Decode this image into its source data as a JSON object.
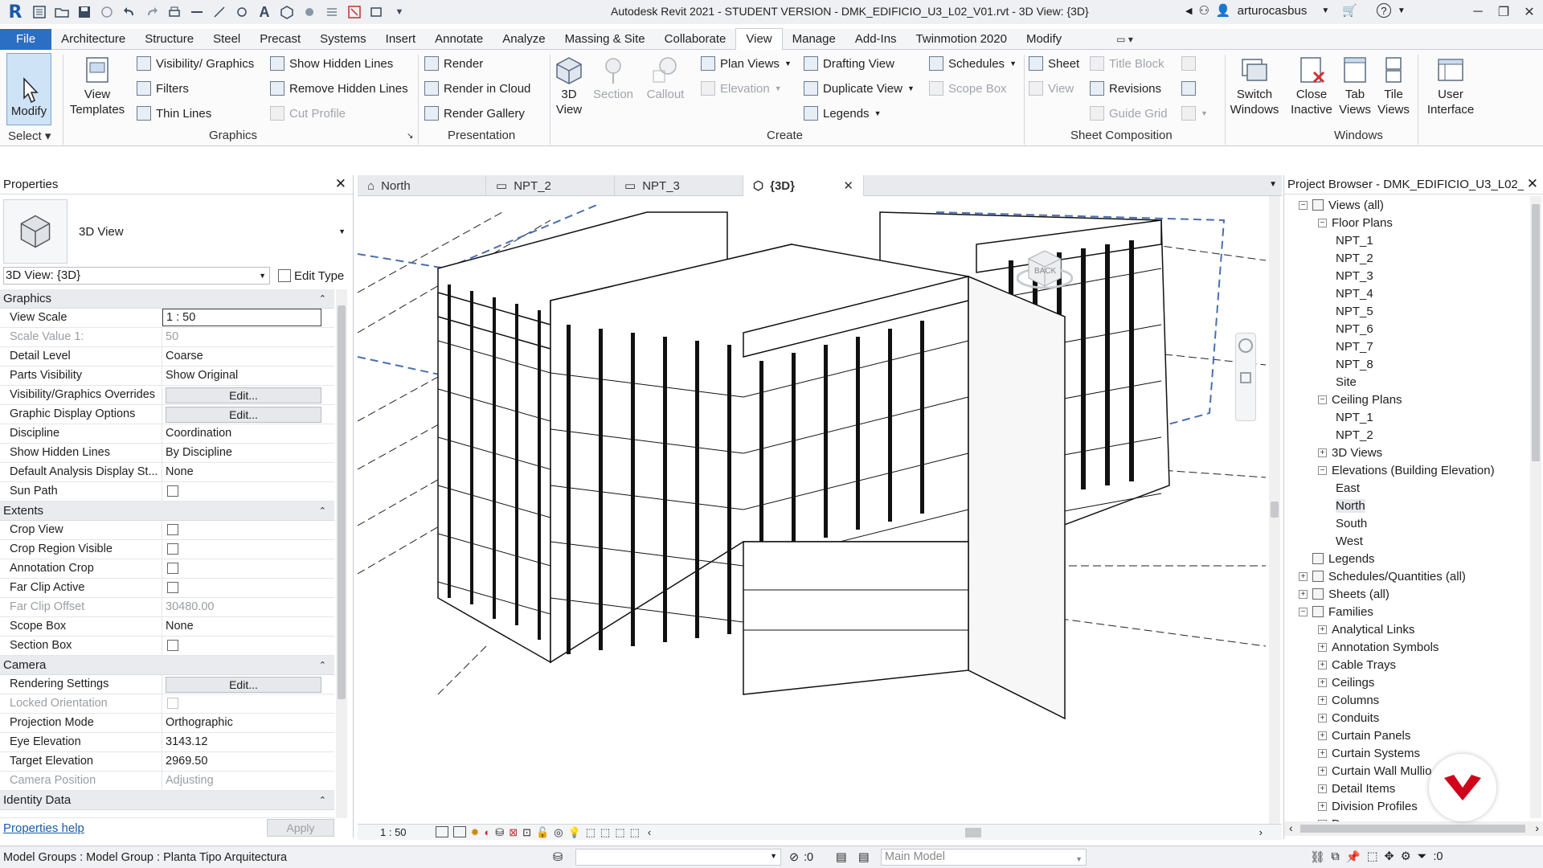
{
  "titlebar": {
    "app_logo": "R",
    "title": "Autodesk Revit 2021 - STUDENT VERSION - DMK_EDIFICIO_U3_L02_V01.rvt - 3D View: {3D}",
    "username": "arturocasbus"
  },
  "ribbon_tabs": [
    "File",
    "Architecture",
    "Structure",
    "Steel",
    "Precast",
    "Systems",
    "Insert",
    "Annotate",
    "Analyze",
    "Massing & Site",
    "Collaborate",
    "View",
    "Manage",
    "Add-Ins",
    "Twinmotion 2020",
    "Modify"
  ],
  "active_tab": "View",
  "ribbon": {
    "modify": "Modify",
    "select": "Select",
    "view_templates": [
      "View",
      "Templates"
    ],
    "graphics": {
      "label": "Graphics",
      "visibility": "Visibility/ Graphics",
      "filters": "Filters",
      "thin_lines": "Thin  Lines",
      "show_hidden": "Show  Hidden Lines",
      "remove_hidden": "Remove  Hidden Lines",
      "cut_profile": "Cut  Profile"
    },
    "presentation": {
      "label": "Presentation",
      "render": "Render",
      "render_cloud": "Render  in Cloud",
      "render_gallery": "Render  Gallery"
    },
    "create": {
      "label": "Create",
      "view3d": [
        "3D",
        "View"
      ],
      "section": "Section",
      "callout": "Callout",
      "plan_views": "Plan  Views",
      "elevation": "Elevation",
      "drafting_view": "Drafting  View",
      "duplicate_view": "Duplicate  View",
      "legends": "Legends",
      "schedules": "Schedules",
      "scope_box": "Scope  Box"
    },
    "sheet_composition": {
      "label": "Sheet Composition",
      "sheet": "Sheet",
      "view": "View",
      "title_block": "Title  Block",
      "revisions": "Revisions",
      "guide_grid": "Guide  Grid"
    },
    "windows": {
      "label": "Windows",
      "switch_windows": [
        "Switch",
        "Windows"
      ],
      "close_inactive": [
        "Close",
        "Inactive"
      ],
      "tab_views": [
        "Tab",
        "Views"
      ],
      "tile_views": [
        "Tile",
        "Views"
      ],
      "user_interface": [
        "User",
        "Interface"
      ]
    }
  },
  "properties": {
    "title": "Properties",
    "type_name": "3D View",
    "selector": "3D View: {3D}",
    "edit_type": "Edit Type",
    "help_link": "Properties help",
    "apply": "Apply",
    "groups": {
      "graphics": "Graphics",
      "extents": "Extents",
      "camera": "Camera",
      "identity": "Identity Data"
    },
    "rows": {
      "view_scale": [
        "View Scale",
        "1 : 50"
      ],
      "scale_value": [
        "Scale Value    1:",
        "50"
      ],
      "detail_level": [
        "Detail Level",
        "Coarse"
      ],
      "parts_visibility": [
        "Parts Visibility",
        "Show Original"
      ],
      "vg_overrides": [
        "Visibility/Graphics Overrides",
        "Edit..."
      ],
      "graphic_display": [
        "Graphic Display Options",
        "Edit..."
      ],
      "discipline": [
        "Discipline",
        "Coordination"
      ],
      "show_hidden_lines": [
        "Show Hidden Lines",
        "By Discipline"
      ],
      "default_analysis": [
        "Default Analysis Display St...",
        "None"
      ],
      "sun_path": [
        "Sun Path",
        ""
      ],
      "crop_view": [
        "Crop View",
        ""
      ],
      "crop_region_visible": [
        "Crop Region Visible",
        ""
      ],
      "annotation_crop": [
        "Annotation Crop",
        ""
      ],
      "far_clip_active": [
        "Far Clip Active",
        ""
      ],
      "far_clip_offset": [
        "Far Clip Offset",
        "30480.00"
      ],
      "scope_box": [
        "Scope Box",
        "None"
      ],
      "section_box": [
        "Section Box",
        ""
      ],
      "rendering_settings": [
        "Rendering Settings",
        "Edit..."
      ],
      "locked_orientation": [
        "Locked Orientation",
        ""
      ],
      "projection_mode": [
        "Projection Mode",
        "Orthographic"
      ],
      "eye_elevation": [
        "Eye Elevation",
        "3143.12"
      ],
      "target_elevation": [
        "Target Elevation",
        "2969.50"
      ],
      "camera_position": [
        "Camera Position",
        "Adjusting"
      ]
    }
  },
  "view_tabs": [
    {
      "label": "North",
      "icon": "elevation-icon"
    },
    {
      "label": "NPT_2",
      "icon": "floor-plan-icon"
    },
    {
      "label": "NPT_3",
      "icon": "floor-plan-icon"
    },
    {
      "label": "{3D}",
      "icon": "3d-view-icon"
    }
  ],
  "viewcube_label": "BACK",
  "view_status": {
    "scale": "1 : 50"
  },
  "project_browser": {
    "title": "Project Browser - DMK_EDIFICIO_U3_L02_...",
    "items": [
      {
        "label": "Views (all)",
        "level": 0,
        "toggle": "-"
      },
      {
        "label": "Floor Plans",
        "level": 1,
        "toggle": "-"
      },
      {
        "label": "NPT_1",
        "level": 2,
        "toggle": ""
      },
      {
        "label": "NPT_2",
        "level": 2,
        "toggle": ""
      },
      {
        "label": "NPT_3",
        "level": 2,
        "toggle": ""
      },
      {
        "label": "NPT_4",
        "level": 2,
        "toggle": ""
      },
      {
        "label": "NPT_5",
        "level": 2,
        "toggle": ""
      },
      {
        "label": "NPT_6",
        "level": 2,
        "toggle": ""
      },
      {
        "label": "NPT_7",
        "level": 2,
        "toggle": ""
      },
      {
        "label": "NPT_8",
        "level": 2,
        "toggle": ""
      },
      {
        "label": "Site",
        "level": 2,
        "toggle": ""
      },
      {
        "label": "Ceiling Plans",
        "level": 1,
        "toggle": "-"
      },
      {
        "label": "NPT_1",
        "level": 2,
        "toggle": ""
      },
      {
        "label": "NPT_2",
        "level": 2,
        "toggle": ""
      },
      {
        "label": "3D Views",
        "level": 1,
        "toggle": "+"
      },
      {
        "label": "Elevations (Building Elevation)",
        "level": 1,
        "toggle": "-"
      },
      {
        "label": "East",
        "level": 2,
        "toggle": ""
      },
      {
        "label": "North",
        "level": 2,
        "toggle": "",
        "selected": true
      },
      {
        "label": "South",
        "level": 2,
        "toggle": ""
      },
      {
        "label": "West",
        "level": 2,
        "toggle": ""
      },
      {
        "label": "Legends",
        "level": 0,
        "toggle": ""
      },
      {
        "label": "Schedules/Quantities (all)",
        "level": 0,
        "toggle": "+"
      },
      {
        "label": "Sheets (all)",
        "level": 0,
        "toggle": "+"
      },
      {
        "label": "Families",
        "level": 0,
        "toggle": "-"
      },
      {
        "label": "Analytical Links",
        "level": 1,
        "toggle": "+"
      },
      {
        "label": "Annotation Symbols",
        "level": 1,
        "toggle": "+"
      },
      {
        "label": "Cable Trays",
        "level": 1,
        "toggle": "+"
      },
      {
        "label": "Ceilings",
        "level": 1,
        "toggle": "+"
      },
      {
        "label": "Columns",
        "level": 1,
        "toggle": "+"
      },
      {
        "label": "Conduits",
        "level": 1,
        "toggle": "+"
      },
      {
        "label": "Curtain Panels",
        "level": 1,
        "toggle": "+"
      },
      {
        "label": "Curtain Systems",
        "level": 1,
        "toggle": "+"
      },
      {
        "label": "Curtain Wall Mullio",
        "level": 1,
        "toggle": "+"
      },
      {
        "label": "Detail Items",
        "level": 1,
        "toggle": "+"
      },
      {
        "label": "Division Profiles",
        "level": 1,
        "toggle": "+"
      },
      {
        "label": "Doors",
        "level": 1,
        "toggle": "+"
      }
    ]
  },
  "statusbar": {
    "message": "Model Groups : Model Group : Planta Tipo Arquitectura",
    "workset_count": ":0",
    "design_option": "Main Model",
    "filter_count": ":0"
  },
  "colors": {
    "accent_blue": "#2a6fc4",
    "brand_red": "#d0021b"
  }
}
